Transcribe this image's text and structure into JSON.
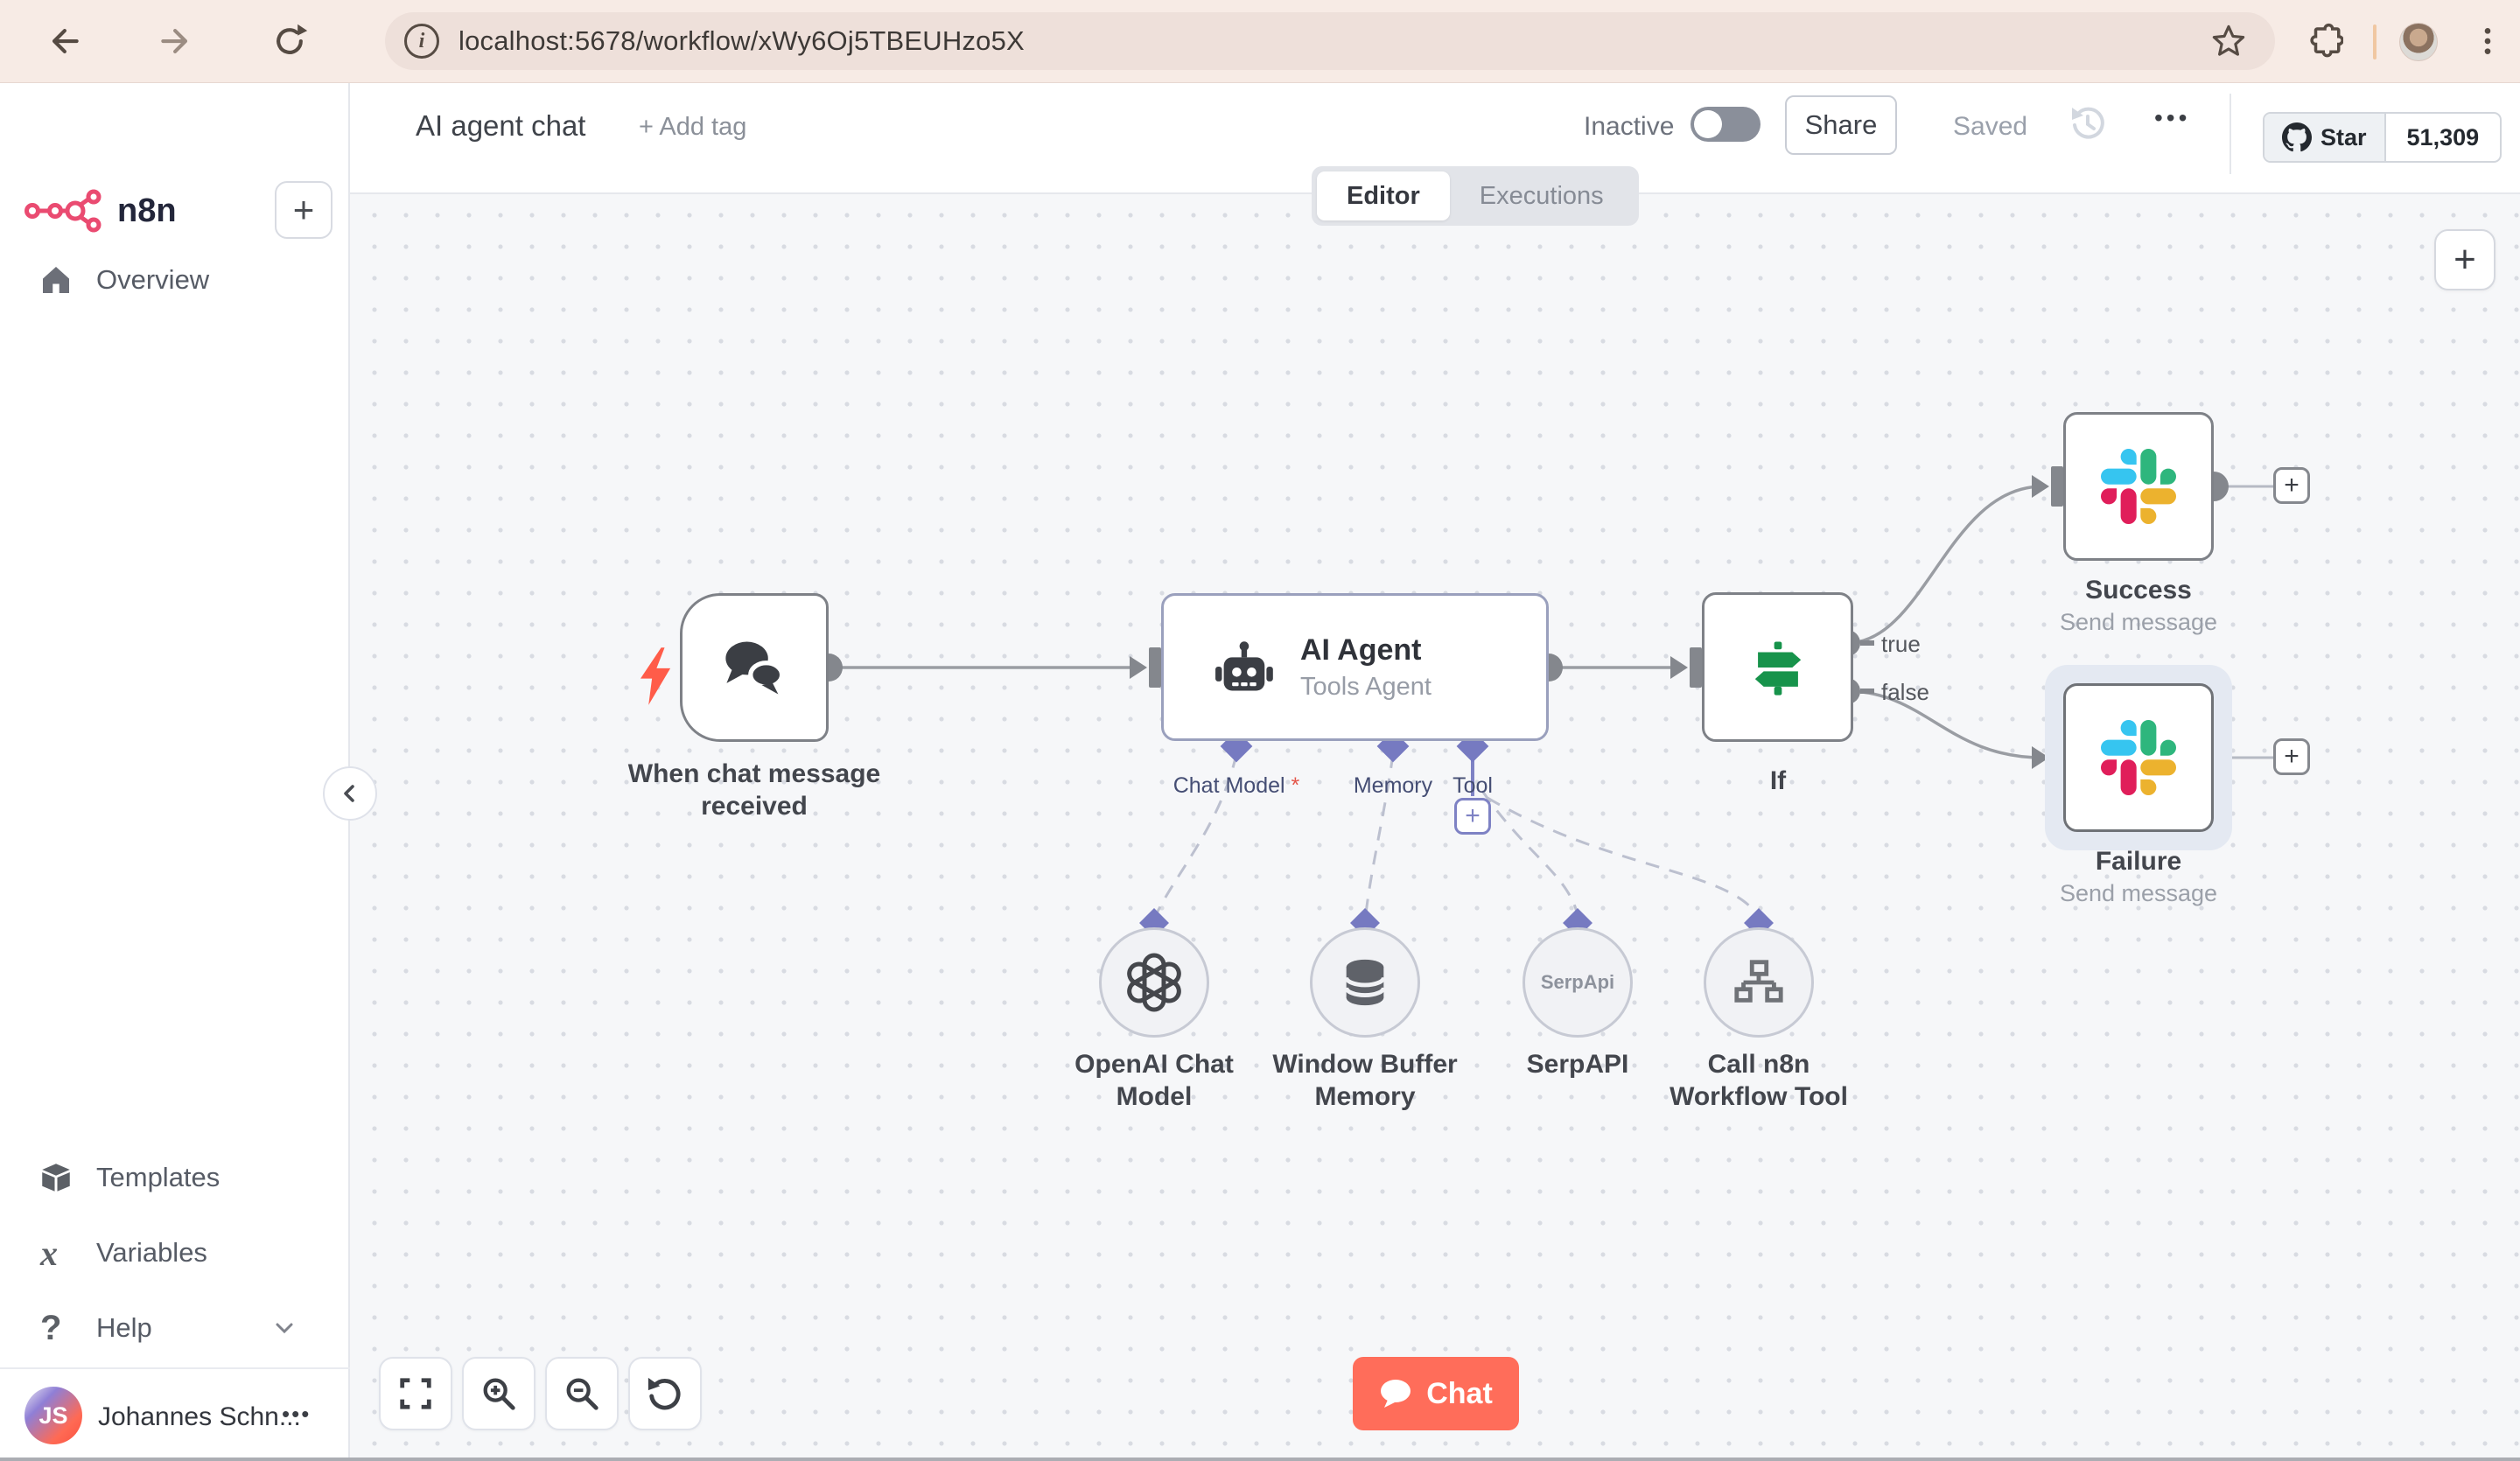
{
  "browser": {
    "url": "localhost:5678/workflow/xWy6Oj5TBEUHzo5X",
    "info_glyph": "i"
  },
  "sidebar": {
    "logo_text": "n8n",
    "items": {
      "overview": "Overview",
      "templates": "Templates",
      "variables": "Variables",
      "help": "Help"
    },
    "icon_glyphs": {
      "variables": "x",
      "help": "?"
    },
    "user": {
      "name": "Johannes Schn...",
      "initials": "JS",
      "menu": "•••"
    }
  },
  "header": {
    "title": "AI agent chat",
    "add_tag": "+ Add tag",
    "activation_label": "Inactive",
    "share_label": "Share",
    "saved_label": "Saved",
    "more_label": "•••",
    "github": {
      "star_label": "Star",
      "star_count": "51,309"
    }
  },
  "tabs": {
    "editor": "Editor",
    "executions": "Executions"
  },
  "canvas": {
    "plus": "+",
    "trigger": {
      "label": "When chat message received"
    },
    "agent": {
      "title": "AI Agent",
      "subtitle": "Tools Agent",
      "ports": {
        "chat_model": "Chat Model",
        "required_mark": "*",
        "memory": "Memory",
        "tool": "Tool"
      }
    },
    "openai": {
      "label": "OpenAI Chat Model"
    },
    "memory_node": {
      "label": "Window Buffer Memory"
    },
    "serpapi": {
      "label": "SerpAPI",
      "badge": "SerpApi"
    },
    "workflow_tool": {
      "label": "Call n8n Workflow Tool"
    },
    "if_node": {
      "label": "If",
      "outputs": {
        "true_label": "true",
        "false_label": "false"
      }
    },
    "success": {
      "label": "Success",
      "subtitle": "Send message"
    },
    "failure": {
      "label": "Failure",
      "subtitle": "Send message"
    }
  },
  "chat_button": {
    "label": "Chat"
  },
  "colors": {
    "accent": "#EA4B71",
    "chat_button": "#ff6d5a",
    "connector": "#9a9da3",
    "supplemental": "#7e82c4",
    "if_green": "#17934b",
    "slack": [
      "#36C5F0",
      "#2EB67D",
      "#ECB22E",
      "#E01E5A"
    ]
  }
}
